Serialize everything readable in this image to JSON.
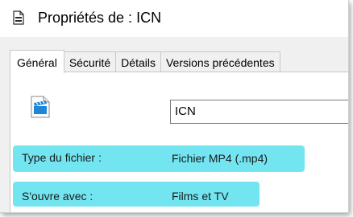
{
  "window": {
    "title": "Propriétés de : ICN",
    "icon": "document-icon"
  },
  "tabs": [
    {
      "label": "Général",
      "active": true
    },
    {
      "label": "Sécurité",
      "active": false
    },
    {
      "label": "Détails",
      "active": false
    },
    {
      "label": "Versions précédentes",
      "active": false
    }
  ],
  "general": {
    "file_icon": "video-file-icon",
    "filename_value": "ICN",
    "rows": [
      {
        "label": "Type du fichier :",
        "value": "Fichier MP4 (.mp4)"
      },
      {
        "label": "S'ouvre avec :",
        "value": "Films et TV"
      }
    ]
  },
  "colors": {
    "highlight": "#66e3f0",
    "window_bg": "#f0f0f0",
    "accent_blue": "#1e88d6"
  }
}
